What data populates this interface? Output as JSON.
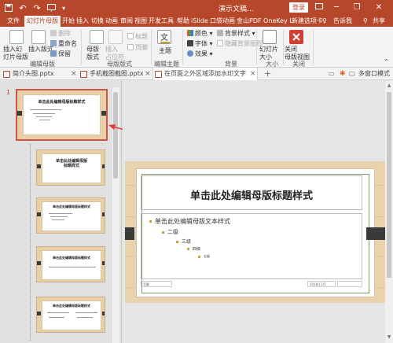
{
  "titlebar": {
    "doc_title": "演示文稿...",
    "login_label": "登录",
    "icons": [
      "save-icon",
      "undo-icon",
      "redo-icon",
      "start-presentation-icon",
      "quick-access-dropdown-icon"
    ],
    "minimize": "─",
    "restore": "❐",
    "close": "✕"
  },
  "tabs": {
    "items": [
      "文件",
      "幻灯片母版",
      "开始",
      "插入",
      "切换",
      "动画",
      "审阅",
      "视图",
      "开发工具",
      "帮助",
      "iSlide",
      "口袋动画",
      "金山PDF",
      "OneKey L",
      "新建选项卡"
    ],
    "active": "幻灯片母版",
    "tell_me": "告诉我",
    "share": "共享"
  },
  "ribbon": {
    "insert_master": "插入幻\n灯片母版",
    "insert_layout": "插入版式",
    "delete": "删除",
    "rename": "重命名",
    "preserve": "保留",
    "group_edit_master": "编辑母版",
    "master_layout": "母版\n版式",
    "insert_placeholder": "插入\n占位符",
    "title_chk": "标题",
    "footer_chk": "页脚",
    "group_master_layout": "母版版式",
    "themes": "主题",
    "group_edit_theme": "编辑主题",
    "colors": "颜色",
    "fonts": "字体",
    "effects": "效果",
    "bg_styles": "背景样式",
    "hide_bg": "隐藏背景图形",
    "group_background": "背景",
    "slide_size": "幻灯片\n大小",
    "group_size": "大小",
    "close_master": "关闭\n母版视图",
    "group_close": "关闭"
  },
  "doctabs": {
    "items": [
      "简介头图.pptx",
      "手机截图截图.pptx",
      "在页面之外区域添加水印文字"
    ],
    "close": "×",
    "window_mode": "多窗口模式"
  },
  "thumbnails": {
    "first_number": "1",
    "title_text": "单击此处编辑母版标题样式",
    "second_title": "单击此处编辑母版\n标题样式"
  },
  "slide": {
    "title": "单击此处编辑母版标题样式",
    "levels": [
      "单击此处编辑母版文本样式",
      "二级",
      "三级",
      "四级",
      "五级"
    ],
    "footer_date": "2018/11/5",
    "footer_left": "页脚"
  },
  "colors": {
    "accent": "#b7472a",
    "selection": "#d0534b",
    "wood": "#e9d3ae"
  }
}
